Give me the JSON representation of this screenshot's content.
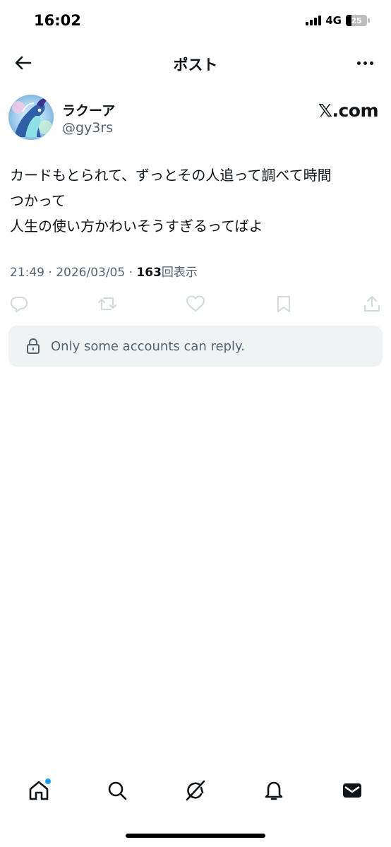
{
  "status_bar": {
    "time": "16:02",
    "network": "4G",
    "battery": "25",
    "battery_level": 0.25
  },
  "header": {
    "title": "ポスト",
    "back_icon": "back-arrow-icon",
    "more_icon": "more-options-icon"
  },
  "author": {
    "name": "ラクーア",
    "handle": "@gy3rs",
    "watermark": "𝕏.com"
  },
  "post": {
    "lines": [
      "カードもとられて、ずっとその人追って調べて時間",
      "つかって",
      "人生の使い方かわいそうすぎるってばよ"
    ]
  },
  "meta": {
    "timestamp": "21:49 · 2026/03/05 · ",
    "views_count": "163",
    "views_label": "回表示"
  },
  "actions": {
    "icons": [
      "reply-icon",
      "repost-icon",
      "like-icon",
      "bookmark-icon",
      "share-icon"
    ]
  },
  "reply_restriction": {
    "text": "Only some accounts can reply."
  },
  "bottom_nav": {
    "items": [
      "home-icon",
      "search-icon",
      "grok-icon",
      "notifications-icon",
      "messages-icon"
    ],
    "accent": "#1d9bf0"
  },
  "colors": {
    "text": "#0f1419",
    "secondary": "#536471",
    "icon_muted": "#cfd9de",
    "reply_box_bg": "#eff3f4"
  }
}
